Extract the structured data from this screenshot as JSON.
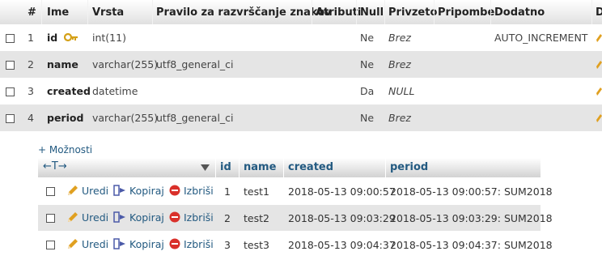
{
  "structure": {
    "headers": [
      "#",
      "Ime",
      "Vrsta",
      "Pravilo za razvrščanje znakov",
      "Atributi",
      "Null",
      "Privzeto",
      "Pripombe",
      "Dodatno",
      "D"
    ],
    "rows": [
      {
        "num": "1",
        "name": "id",
        "type": "int(11)",
        "collation": "",
        "null": "Ne",
        "default": "Brez",
        "extra": "AUTO_INCREMENT",
        "primary_key": true
      },
      {
        "num": "2",
        "name": "name",
        "type": "varchar(255)",
        "collation": "utf8_general_ci",
        "null": "Ne",
        "default": "Brez",
        "extra": ""
      },
      {
        "num": "3",
        "name": "created",
        "type": "datetime",
        "collation": "",
        "null": "Da",
        "default": "NULL",
        "extra": ""
      },
      {
        "num": "4",
        "name": "period",
        "type": "varchar(255)",
        "collation": "utf8_general_ci",
        "null": "Ne",
        "default": "Brez",
        "extra": ""
      }
    ]
  },
  "results": {
    "options_label": "+ Možnosti",
    "sort_arrows": "←T→",
    "headers": [
      "id",
      "name",
      "created",
      "period"
    ],
    "actions": {
      "edit": "Uredi",
      "copy": "Kopiraj",
      "delete": "Izbriši"
    },
    "rows": [
      {
        "id": "1",
        "name": "test1",
        "created": "2018-05-13 09:00:57",
        "period": "2018-05-13 09:00:57: SUM2018"
      },
      {
        "id": "2",
        "name": "test2",
        "created": "2018-05-13 09:03:29",
        "period": "2018-05-13 09:03:29: SUM2018"
      },
      {
        "id": "3",
        "name": "test3",
        "created": "2018-05-13 09:04:37",
        "period": "2018-05-13 09:04:37: SUM2018"
      }
    ]
  },
  "colors": {
    "link": "#235a81",
    "row_alt": "#e5e5e5",
    "delete_icon": "#d9302a",
    "pencil": "#e0a020"
  }
}
